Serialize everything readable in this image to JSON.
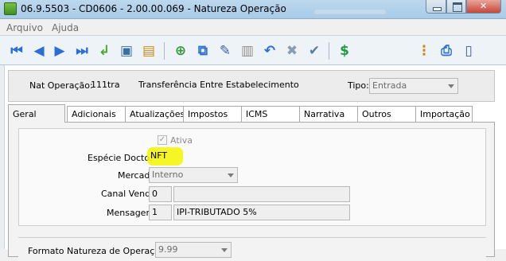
{
  "window": {
    "title": "06.9.5503 - CD0606 - 2.00.00.069 - Natureza Operação"
  },
  "menu": [
    "Arquivo",
    "Ajuda"
  ],
  "toolbar": {
    "icons": [
      "first-icon",
      "previous-icon",
      "next-icon",
      "last-icon",
      "return-icon",
      "zoom-icon",
      "list-icon",
      "add-icon",
      "copy-icon",
      "edit-icon",
      "delete-icon",
      "undo-icon",
      "cancel-icon",
      "confirm-icon",
      "money-icon",
      "tree-icon",
      "print-icon",
      "exit-icon"
    ]
  },
  "header": {
    "nat_label": "Nat Operação:",
    "nat_code": "111tra",
    "nat_desc": "Transferência Entre Estabelecimento",
    "tipo_label": "Tipo:",
    "tipo_value": "Entrada"
  },
  "tabs": [
    "Geral",
    "Adicionais",
    "Atualizações",
    "Impostos",
    "ICMS",
    "Narrativa",
    "Outros",
    "Importação"
  ],
  "form": {
    "ativa_label": "Ativa",
    "ativa_checked": true,
    "especie_label": "Espécie Docto:",
    "especie_value": "NFT",
    "mercado_label": "Mercado:",
    "mercado_value": "Interno",
    "canal_label": "Canal Venda:",
    "canal_value": "0",
    "canal_desc": "",
    "mensagem_label": "Mensagem:",
    "mensagem_value": "1",
    "mensagem_desc": "IPI-TRIBUTADO 5%",
    "formato_label": "Formato Natureza de Operação:",
    "formato_value": "9.99"
  },
  "colors": {
    "highlight": "#f5f500",
    "titlebar": "#bcd8ee"
  }
}
